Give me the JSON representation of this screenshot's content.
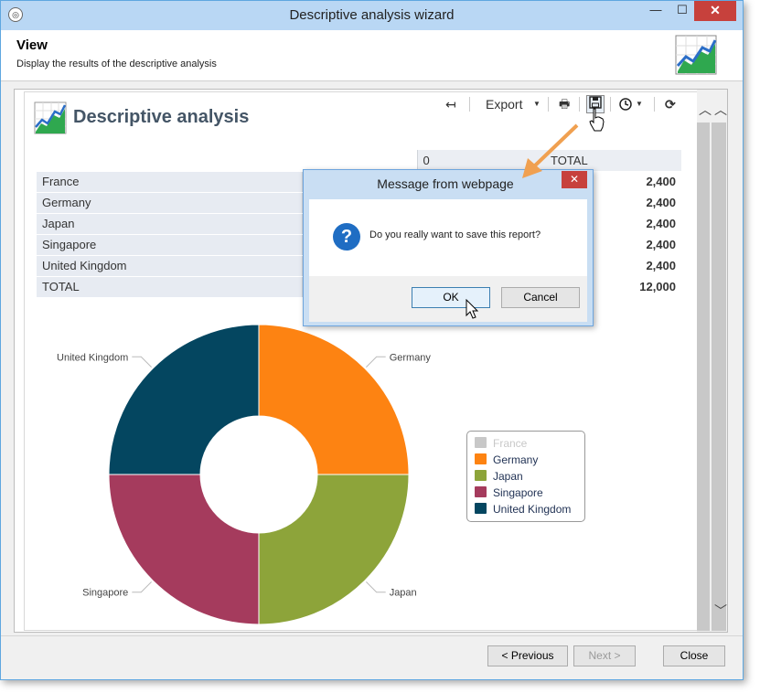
{
  "window": {
    "title": "Descriptive analysis wizard",
    "minimize": "—",
    "maximize": "☐",
    "close": "✕"
  },
  "header": {
    "title": "View",
    "subtitle": "Display the results of the descriptive analysis"
  },
  "report": {
    "title": "Descriptive analysis",
    "toolbar": {
      "back": "↤",
      "export_label": "Export",
      "export_caret": "▼",
      "print": "🖶",
      "save": "💾",
      "history_caret": "▼",
      "refresh": "⟳"
    },
    "table": {
      "headers": [
        "0",
        "TOTAL"
      ],
      "rows": [
        {
          "label": "France",
          "total": "2,400"
        },
        {
          "label": "Germany",
          "total": "2,400"
        },
        {
          "label": "Japan",
          "total": "2,400"
        },
        {
          "label": "Singapore",
          "total": "2,400"
        },
        {
          "label": "United Kingdom",
          "total": "2,400"
        },
        {
          "label": "TOTAL",
          "total": "12,000"
        }
      ]
    }
  },
  "chart_data": {
    "type": "pie",
    "donut": true,
    "categories": [
      "France",
      "Germany",
      "Japan",
      "Singapore",
      "United Kingdom"
    ],
    "values": [
      0,
      25,
      25,
      25,
      25
    ],
    "colors": [
      "#c8c8c8",
      "#fd8312",
      "#8da43a",
      "#a53b5d",
      "#044660"
    ],
    "legend_disabled": [
      "France"
    ],
    "legend": "right"
  },
  "dialog": {
    "title": "Message from webpage",
    "close": "✕",
    "message": "Do you really want to save this report?",
    "ok": "OK",
    "cancel": "Cancel"
  },
  "footer": {
    "previous": "< Previous",
    "next": "Next >",
    "close": "Close"
  },
  "colors": {
    "accent": "#5fa7e0",
    "arrow": "#f0a050"
  }
}
